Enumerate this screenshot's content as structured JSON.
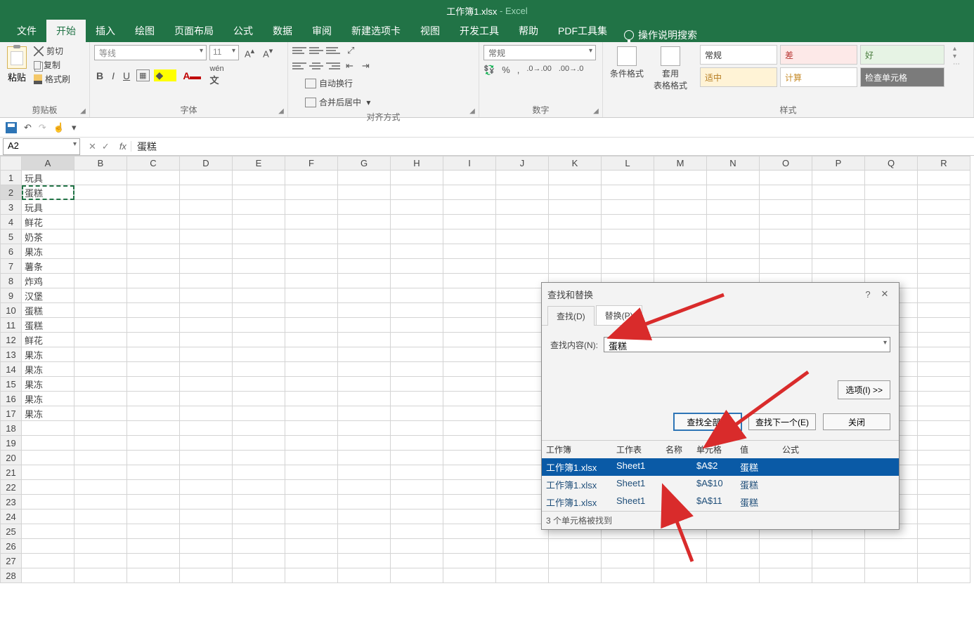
{
  "title": {
    "file": "工作簿1.xlsx",
    "app": "Excel"
  },
  "tabs": [
    "文件",
    "开始",
    "插入",
    "绘图",
    "页面布局",
    "公式",
    "数据",
    "审阅",
    "新建选项卡",
    "视图",
    "开发工具",
    "帮助",
    "PDF工具集"
  ],
  "tell_me": "操作说明搜索",
  "ribbon": {
    "clipboard": {
      "label": "剪贴板",
      "paste": "粘贴",
      "cut": "剪切",
      "copy": "复制",
      "fmt": "格式刷"
    },
    "font": {
      "label": "字体",
      "name": "等线",
      "size": "11"
    },
    "align": {
      "label": "对齐方式",
      "wrap": "自动换行",
      "merge": "合并后居中"
    },
    "number": {
      "label": "数字",
      "format": "常规"
    },
    "styles": {
      "label": "样式",
      "cond": "条件格式",
      "table": "套用\n表格格式",
      "cells": [
        {
          "text": "常规",
          "bg": "#ffffff",
          "color": "#333"
        },
        {
          "text": "差",
          "bg": "#fde9e8",
          "color": "#b93835"
        },
        {
          "text": "好",
          "bg": "#e6f3e4",
          "color": "#4b7e3f"
        },
        {
          "text": "适中",
          "bg": "#fff3d6",
          "color": "#b57b1e"
        },
        {
          "text": "计算",
          "bg": "#fff",
          "color": "#c68b2a"
        },
        {
          "text": "检查单元格",
          "bg": "#7b7b7b",
          "color": "#fff"
        }
      ]
    }
  },
  "namebox": "A2",
  "formula": "蛋糕",
  "columns": [
    "A",
    "B",
    "C",
    "D",
    "E",
    "F",
    "G",
    "H",
    "I",
    "J",
    "K",
    "L",
    "M",
    "N",
    "O",
    "P",
    "Q",
    "R"
  ],
  "rows": [
    "玩具",
    "蛋糕",
    "玩具",
    "鲜花",
    "奶茶",
    "果冻",
    "薯条",
    "炸鸡",
    "汉堡",
    "蛋糕",
    "蛋糕",
    "鲜花",
    "果冻",
    "果冻",
    "果冻",
    "果冻",
    "果冻"
  ],
  "dialog": {
    "title": "查找和替换",
    "tab_find": "查找(D)",
    "tab_replace": "替换(P)",
    "find_label": "查找内容(N):",
    "find_value": "蛋糕",
    "options": "选项(I) >>",
    "find_all": "查找全部(I)",
    "find_next": "查找下一个(E)",
    "close": "关闭",
    "head": {
      "wb": "工作簿",
      "ws": "工作表",
      "nm": "名称",
      "cell": "单元格",
      "val": "值",
      "fm": "公式"
    },
    "rows": [
      {
        "wb": "工作簿1.xlsx",
        "ws": "Sheet1",
        "nm": "",
        "cell": "$A$2",
        "val": "蛋糕",
        "sel": true
      },
      {
        "wb": "工作簿1.xlsx",
        "ws": "Sheet1",
        "nm": "",
        "cell": "$A$10",
        "val": "蛋糕",
        "sel": false
      },
      {
        "wb": "工作簿1.xlsx",
        "ws": "Sheet1",
        "nm": "",
        "cell": "$A$11",
        "val": "蛋糕",
        "sel": false
      }
    ],
    "status": "3 个单元格被找到"
  }
}
